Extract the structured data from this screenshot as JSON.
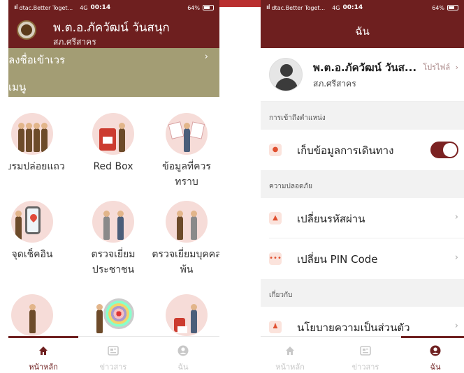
{
  "status_left": {
    "signal": "ııl",
    "carrier": "dtac.Better Toget...",
    "network": "4G",
    "time": "00:14",
    "battery": "64%"
  },
  "status_right": {
    "signal": "ııl",
    "carrier": "dtac.Better Toget...",
    "network": "4G",
    "time": "00:14",
    "battery": "64%"
  },
  "home": {
    "officer_name": "พ.ต.อ.ภัควัฒน์ วันสนุก",
    "station": "สภ.ศรีสาคร",
    "checkin_label": "ลงชื่อเข้าเวร",
    "checkin_chevron": "›",
    "menu_heading": "เมนู",
    "tiles": [
      {
        "label": "อบรมปล่อยแถว",
        "icon": "police-lineup-icon"
      },
      {
        "label": "Red Box",
        "icon": "red-box-icon"
      },
      {
        "label": "ข้อมูลที่ควรทราบ",
        "icon": "information-icon"
      },
      {
        "label": "จุดเช็คอิน",
        "icon": "checkin-map-icon"
      },
      {
        "label": "ตรวจเยี่ยมประชาชน",
        "icon": "visit-citizen-icon"
      },
      {
        "label": "ตรวจเยี่ยมบุคคลพ้น",
        "icon": "visit-released-person-icon"
      },
      {
        "label": "",
        "icon": "officer-desk-icon"
      },
      {
        "label": "",
        "icon": "target-icon"
      },
      {
        "label": "",
        "icon": "officer-equipment-icon"
      }
    ]
  },
  "tabbar": {
    "home": "หน้าหลัก",
    "news": "ข่าวสาร",
    "me": "ฉัน",
    "home_icon": "house-icon",
    "news_icon": "newspaper-icon",
    "me_icon": "user-circle-icon"
  },
  "profile": {
    "page_title": "ฉัน",
    "name": "พ.ต.อ.ภัควัฒน์ วันส...",
    "station": "สภ.ศรีสาคร",
    "profile_link": "โปรไฟล์",
    "chevron": "›",
    "sections": [
      {
        "heading": "การเข้าถึงตำแหน่ง",
        "rows": [
          {
            "label": "เก็บข้อมูลการเดินทาง",
            "icon": "location-pin-icon",
            "control": "toggle",
            "on": true
          }
        ]
      },
      {
        "heading": "ความปลอดภัย",
        "rows": [
          {
            "label": "เปลี่ยนรหัสผ่าน",
            "icon": "lock-icon",
            "control": "chevron"
          },
          {
            "label": "เปลี่ยน PIN Code",
            "icon": "pin-dots-icon",
            "icon_text": "•••",
            "control": "chevron"
          }
        ]
      },
      {
        "heading": "เกี่ยวกับ",
        "rows": [
          {
            "label": "นโยบายความเป็นส่วนตัว",
            "icon": "privacy-user-lock-icon",
            "control": "chevron"
          }
        ]
      }
    ]
  },
  "colors": {
    "primary": "#6e1f1f",
    "khaki": "#a39d74",
    "accent_tab": "#b92f2f",
    "toggle_on": "#7b2222"
  }
}
